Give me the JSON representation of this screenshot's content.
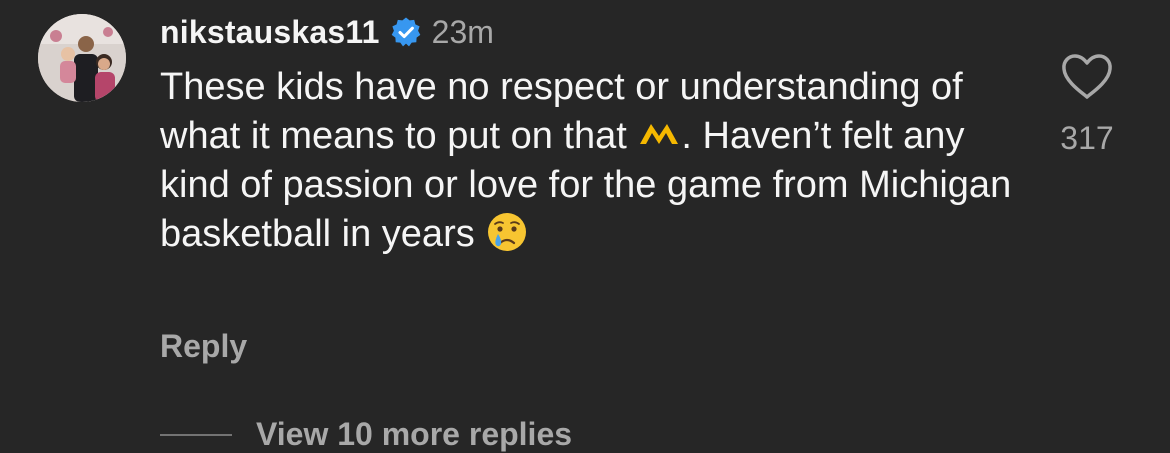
{
  "comment": {
    "username": "nikstauskas11",
    "verified": true,
    "timestamp": "23m",
    "text_part1": "These kids have no respect or understanding of what it means to put on that ",
    "text_part2": ". Haven’t felt any kind of passion or love for the game from Michigan basketball in years ",
    "inline_emoji_1": "michigan-m-logo-icon",
    "inline_emoji_2": "crying-face-icon",
    "reply_label": "Reply",
    "like_count": "317",
    "view_replies_label": "View 10 more replies"
  },
  "colors": {
    "background": "#262626",
    "primary_text": "#f5f5f5",
    "secondary_text": "#a8a8a8",
    "verified_blue": "#3797f0",
    "michigan_maize": "#f5b800"
  }
}
